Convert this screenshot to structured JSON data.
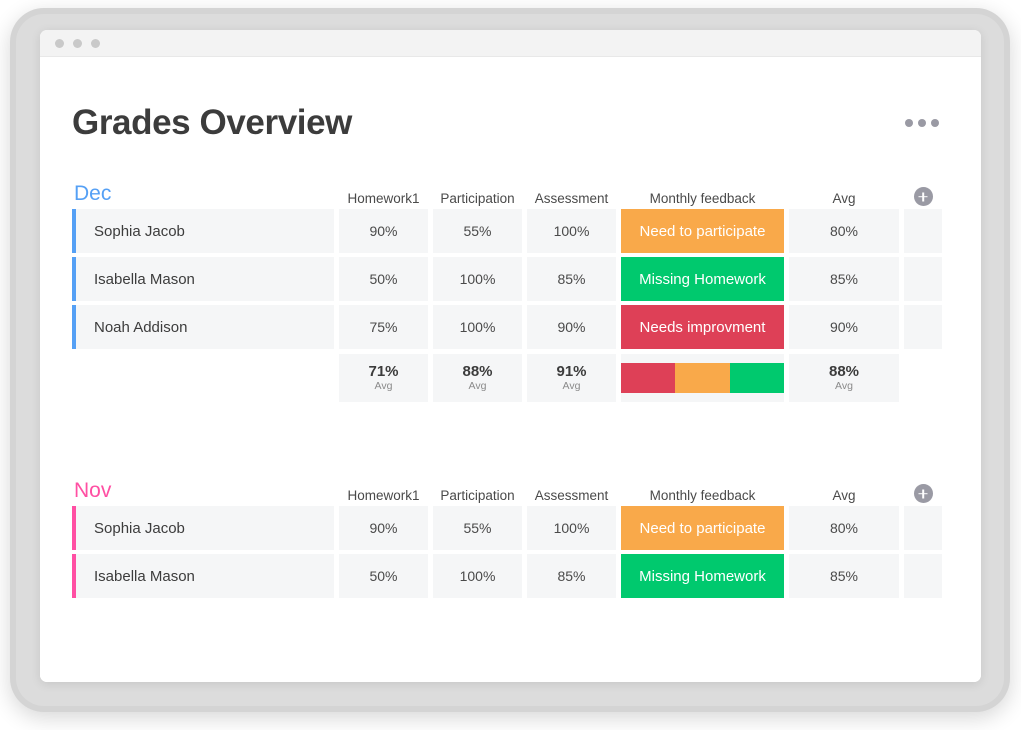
{
  "window": {
    "dots": [
      "close",
      "minimize",
      "maximize"
    ]
  },
  "header": {
    "title": "Grades Overview",
    "menu_icon": "kebab-menu-icon"
  },
  "columns": {
    "name": "",
    "metrics": [
      "Homework1",
      "Participation",
      "Assessment"
    ],
    "feedback": "Monthly feedback",
    "avg": "Avg",
    "add": "add-column-icon"
  },
  "colors": {
    "dec_accent": "#55a0f5",
    "nov_accent": "#ff4fa3",
    "orange": "#f9a94a",
    "green": "#00c96e",
    "red": "#de4057",
    "cell_bg": "#f5f6f7"
  },
  "sections": [
    {
      "month": "Dec",
      "accent": "#55a0f5",
      "rows": [
        {
          "name": "Sophia Jacob",
          "homework1": "90%",
          "participation": "55%",
          "assessment": "100%",
          "feedback": "Need to participate",
          "feedback_color": "#f9a94a",
          "avg": "80%"
        },
        {
          "name": "Isabella Mason",
          "homework1": "50%",
          "participation": "100%",
          "assessment": "85%",
          "feedback": "Missing Homework",
          "feedback_color": "#00c96e",
          "avg": "85%"
        },
        {
          "name": "Noah Addison",
          "homework1": "75%",
          "participation": "100%",
          "assessment": "90%",
          "feedback": "Needs improvment",
          "feedback_color": "#de4057",
          "avg": "90%"
        }
      ],
      "summary": {
        "label": "Avg",
        "homework1": "71%",
        "participation": "88%",
        "assessment": "91%",
        "avg": "88%",
        "distribution": [
          {
            "color": "#de4057",
            "share": 33.33
          },
          {
            "color": "#f9a94a",
            "share": 33.33
          },
          {
            "color": "#00c96e",
            "share": 33.33
          }
        ]
      }
    },
    {
      "month": "Nov",
      "accent": "#ff4fa3",
      "rows": [
        {
          "name": "Sophia Jacob",
          "homework1": "90%",
          "participation": "55%",
          "assessment": "100%",
          "feedback": "Need to participate",
          "feedback_color": "#f9a94a",
          "avg": "80%"
        },
        {
          "name": "Isabella Mason",
          "homework1": "50%",
          "participation": "100%",
          "assessment": "85%",
          "feedback": "Missing Homework",
          "feedback_color": "#00c96e",
          "avg": "85%"
        }
      ],
      "summary": null
    }
  ]
}
